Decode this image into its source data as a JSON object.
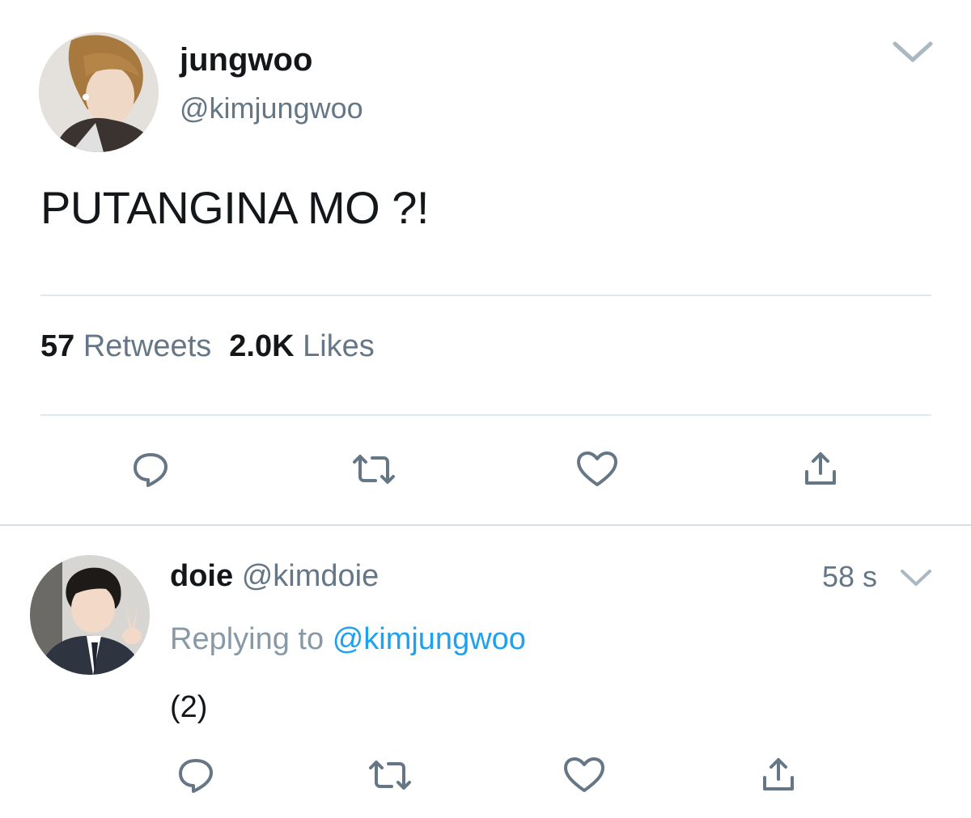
{
  "main_tweet": {
    "author_name": "jungwoo",
    "author_handle": "@kimjungwoo",
    "text": "PUTANGINA MO ?!",
    "retweet_count": "57",
    "retweet_label": "Retweets",
    "like_count": "2.0K",
    "like_label": "Likes",
    "actions": [
      "reply-icon",
      "retweet-icon",
      "like-icon",
      "share-icon"
    ],
    "menu_icon": "chevron-down-icon"
  },
  "reply": {
    "author_name": "doie",
    "author_handle": "@kimdoie",
    "time": "58 s",
    "replying_prefix": "Replying to",
    "replying_handle": "@kimjungwoo",
    "text": "(2)",
    "actions": [
      "reply-icon",
      "retweet-icon",
      "like-icon",
      "share-icon"
    ],
    "menu_icon": "chevron-down-icon"
  },
  "colors": {
    "text_primary": "#14171a",
    "text_secondary": "#657786",
    "icon_gray": "#657786",
    "link_blue": "#1da1f2",
    "divider": "#e1e8ed"
  }
}
